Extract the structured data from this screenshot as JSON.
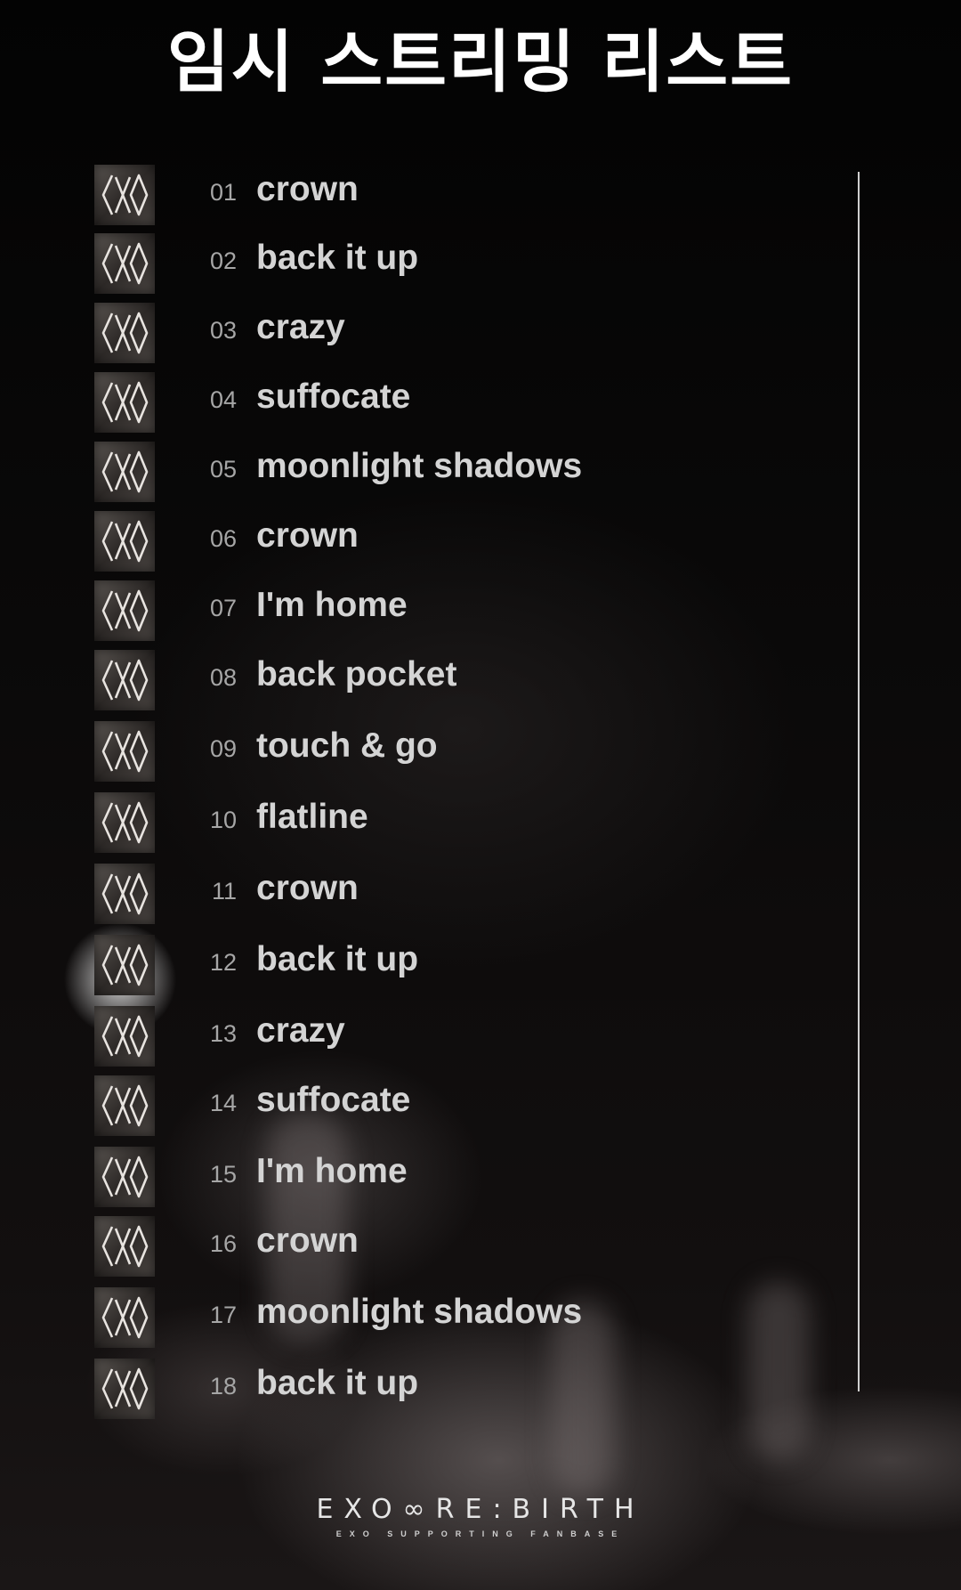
{
  "header": {
    "title": "임시 스트리밍 리스트"
  },
  "tracks": [
    {
      "number": "01",
      "title": "crown"
    },
    {
      "number": "02",
      "title": "back it up"
    },
    {
      "number": "03",
      "title": "crazy"
    },
    {
      "number": "04",
      "title": "suffocate"
    },
    {
      "number": "05",
      "title": "moonlight shadows"
    },
    {
      "number": "06",
      "title": "crown"
    },
    {
      "number": "07",
      "title": "I'm home"
    },
    {
      "number": "08",
      "title": "back pocket"
    },
    {
      "number": "09",
      "title": "touch & go"
    },
    {
      "number": "10",
      "title": "flatline"
    },
    {
      "number": "11",
      "title": "crown"
    },
    {
      "number": "12",
      "title": "back it up"
    },
    {
      "number": "13",
      "title": "crazy"
    },
    {
      "number": "14",
      "title": "suffocate"
    },
    {
      "number": "15",
      "title": "I'm home"
    },
    {
      "number": "16",
      "title": "crown"
    },
    {
      "number": "17",
      "title": "moonlight shadows"
    },
    {
      "number": "18",
      "title": "back it up"
    }
  ],
  "thumbnail_icon": "exo-logo-icon",
  "footer": {
    "logo": "EXO∞RE:BIRTH",
    "subtitle": "EXO SUPPORTING FANBASE"
  },
  "colors": {
    "background": "#050505",
    "title": "#ffffff",
    "track_title": "#d4d4d4",
    "track_number": "#a6a6a6"
  }
}
